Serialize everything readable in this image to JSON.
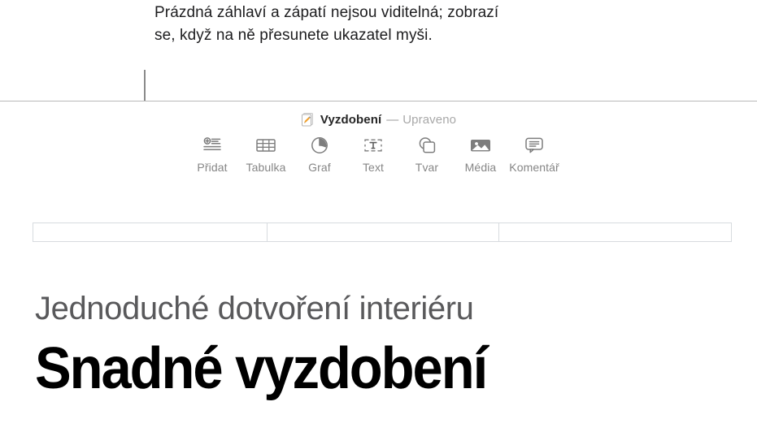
{
  "callout": {
    "text": "Prázdná záhlaví a zápatí nejsou viditelná; zobrazí se, když na ně přesunete ukazatel myši."
  },
  "titlebar": {
    "doc_icon": "pages-document-icon",
    "title": "Vyzdobení",
    "separator": "—",
    "status": "Upraveno"
  },
  "toolbar": {
    "items": [
      {
        "label": "Přidat",
        "icon": "add-list-icon"
      },
      {
        "label": "Tabulka",
        "icon": "table-icon"
      },
      {
        "label": "Graf",
        "icon": "pie-chart-icon"
      },
      {
        "label": "Text",
        "icon": "text-box-icon"
      },
      {
        "label": "Tvar",
        "icon": "shape-icon"
      },
      {
        "label": "Média",
        "icon": "media-image-icon"
      },
      {
        "label": "Komentář",
        "icon": "comment-bubble-icon"
      }
    ]
  },
  "header_fields": {
    "left": "",
    "center": "",
    "right": ""
  },
  "document": {
    "subtitle": "Jednoduché dotvoření interiéru",
    "heading": "Snadné vyzdobení"
  },
  "colors": {
    "icon_gray": "#868686",
    "label_gray": "#868686",
    "title_dark": "#262626",
    "status_gray": "#a8a8a8",
    "field_border": "#d7dbdf",
    "leader_line": "#8a8a8a",
    "subtitle_gray": "#59595b",
    "heading_black": "#000000"
  }
}
